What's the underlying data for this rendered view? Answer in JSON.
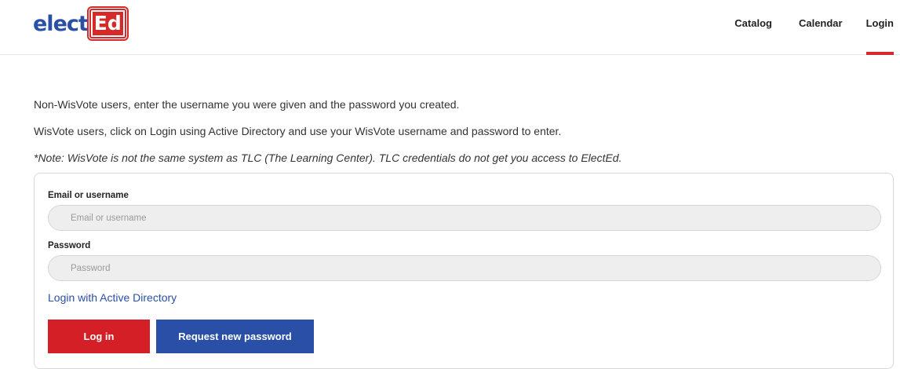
{
  "header": {
    "logo_text": "elect",
    "logo_box": "Ed",
    "nav": [
      {
        "label": "Catalog"
      },
      {
        "label": "Calendar"
      },
      {
        "label": "Login"
      }
    ]
  },
  "intro": {
    "line1": "Non-WisVote users, enter the username you were given and the password you created.",
    "line2": "WisVote users, click on Login using Active Directory and use your WisVote username and password to enter.",
    "note": "*Note: WisVote is not the same system as TLC (The Learning Center). TLC credentials do not get you access to ElectEd."
  },
  "form": {
    "email_label": "Email or username",
    "email_placeholder": "Email or username",
    "email_value": "",
    "password_label": "Password",
    "password_placeholder": "Password",
    "password_value": "",
    "ad_link": "Login with Active Directory",
    "login_button": "Log in",
    "request_button": "Request new password"
  },
  "colors": {
    "brand_blue": "#2a4fa6",
    "brand_red": "#d41f26"
  }
}
